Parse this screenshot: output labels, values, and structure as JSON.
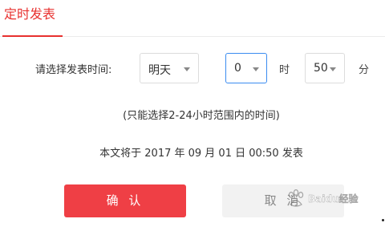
{
  "tab": {
    "label": "定时发表"
  },
  "schedule": {
    "label": "请选择发表时间:",
    "day": {
      "selected": "明天"
    },
    "hour": {
      "selected": "0"
    },
    "hour_unit": "时",
    "minute": {
      "selected": "50"
    },
    "minute_unit": "分"
  },
  "hint": "(只能选择2-24小时范围内的时间)",
  "publish_info": "本文将于 2017 年 09 月 01 日 00:50 发表",
  "buttons": {
    "confirm": "确 认",
    "cancel": "取 消"
  },
  "watermark": {
    "text": "Baidu经验"
  },
  "colors": {
    "accent": "#e8312f",
    "confirm_bg": "#ef3f45",
    "focus_border": "#3b8cf0",
    "cancel_bg": "#f2f2f2"
  }
}
